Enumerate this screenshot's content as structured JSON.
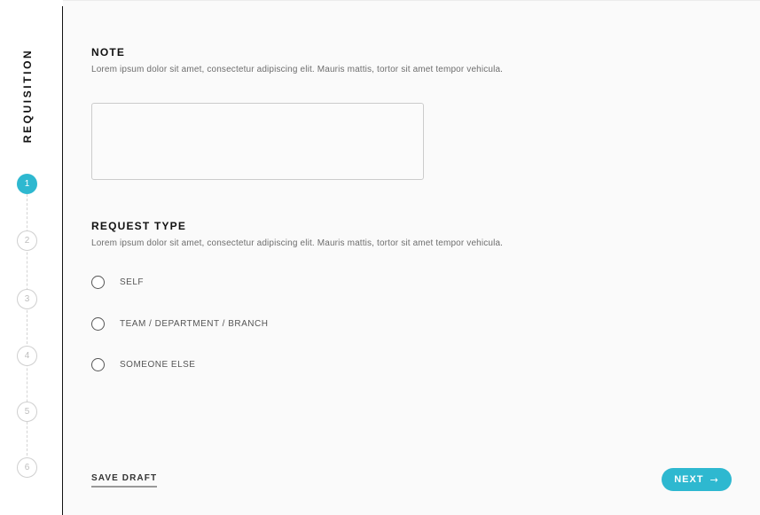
{
  "sidebar": {
    "title": "REQUISITION",
    "steps": [
      "1",
      "2",
      "3",
      "4",
      "5",
      "6"
    ],
    "active_step": 1,
    "accent_color": "#2eb8d0"
  },
  "note": {
    "title": "NOTE",
    "description": "Lorem ipsum dolor sit amet, consectetur adipiscing elit. Mauris mattis, tortor sit amet tempor vehicula.",
    "value": ""
  },
  "request_type": {
    "title": "REQUEST TYPE",
    "description": "Lorem ipsum dolor sit amet, consectetur adipiscing elit. Mauris mattis, tortor sit amet tempor vehicula.",
    "options": [
      "SELF",
      "TEAM / DEPARTMENT / BRANCH",
      "SOMEONE ELSE"
    ]
  },
  "footer": {
    "save_draft_label": "SAVE DRAFT",
    "next_label": "NEXT",
    "next_icon": "arrow-right-icon"
  }
}
